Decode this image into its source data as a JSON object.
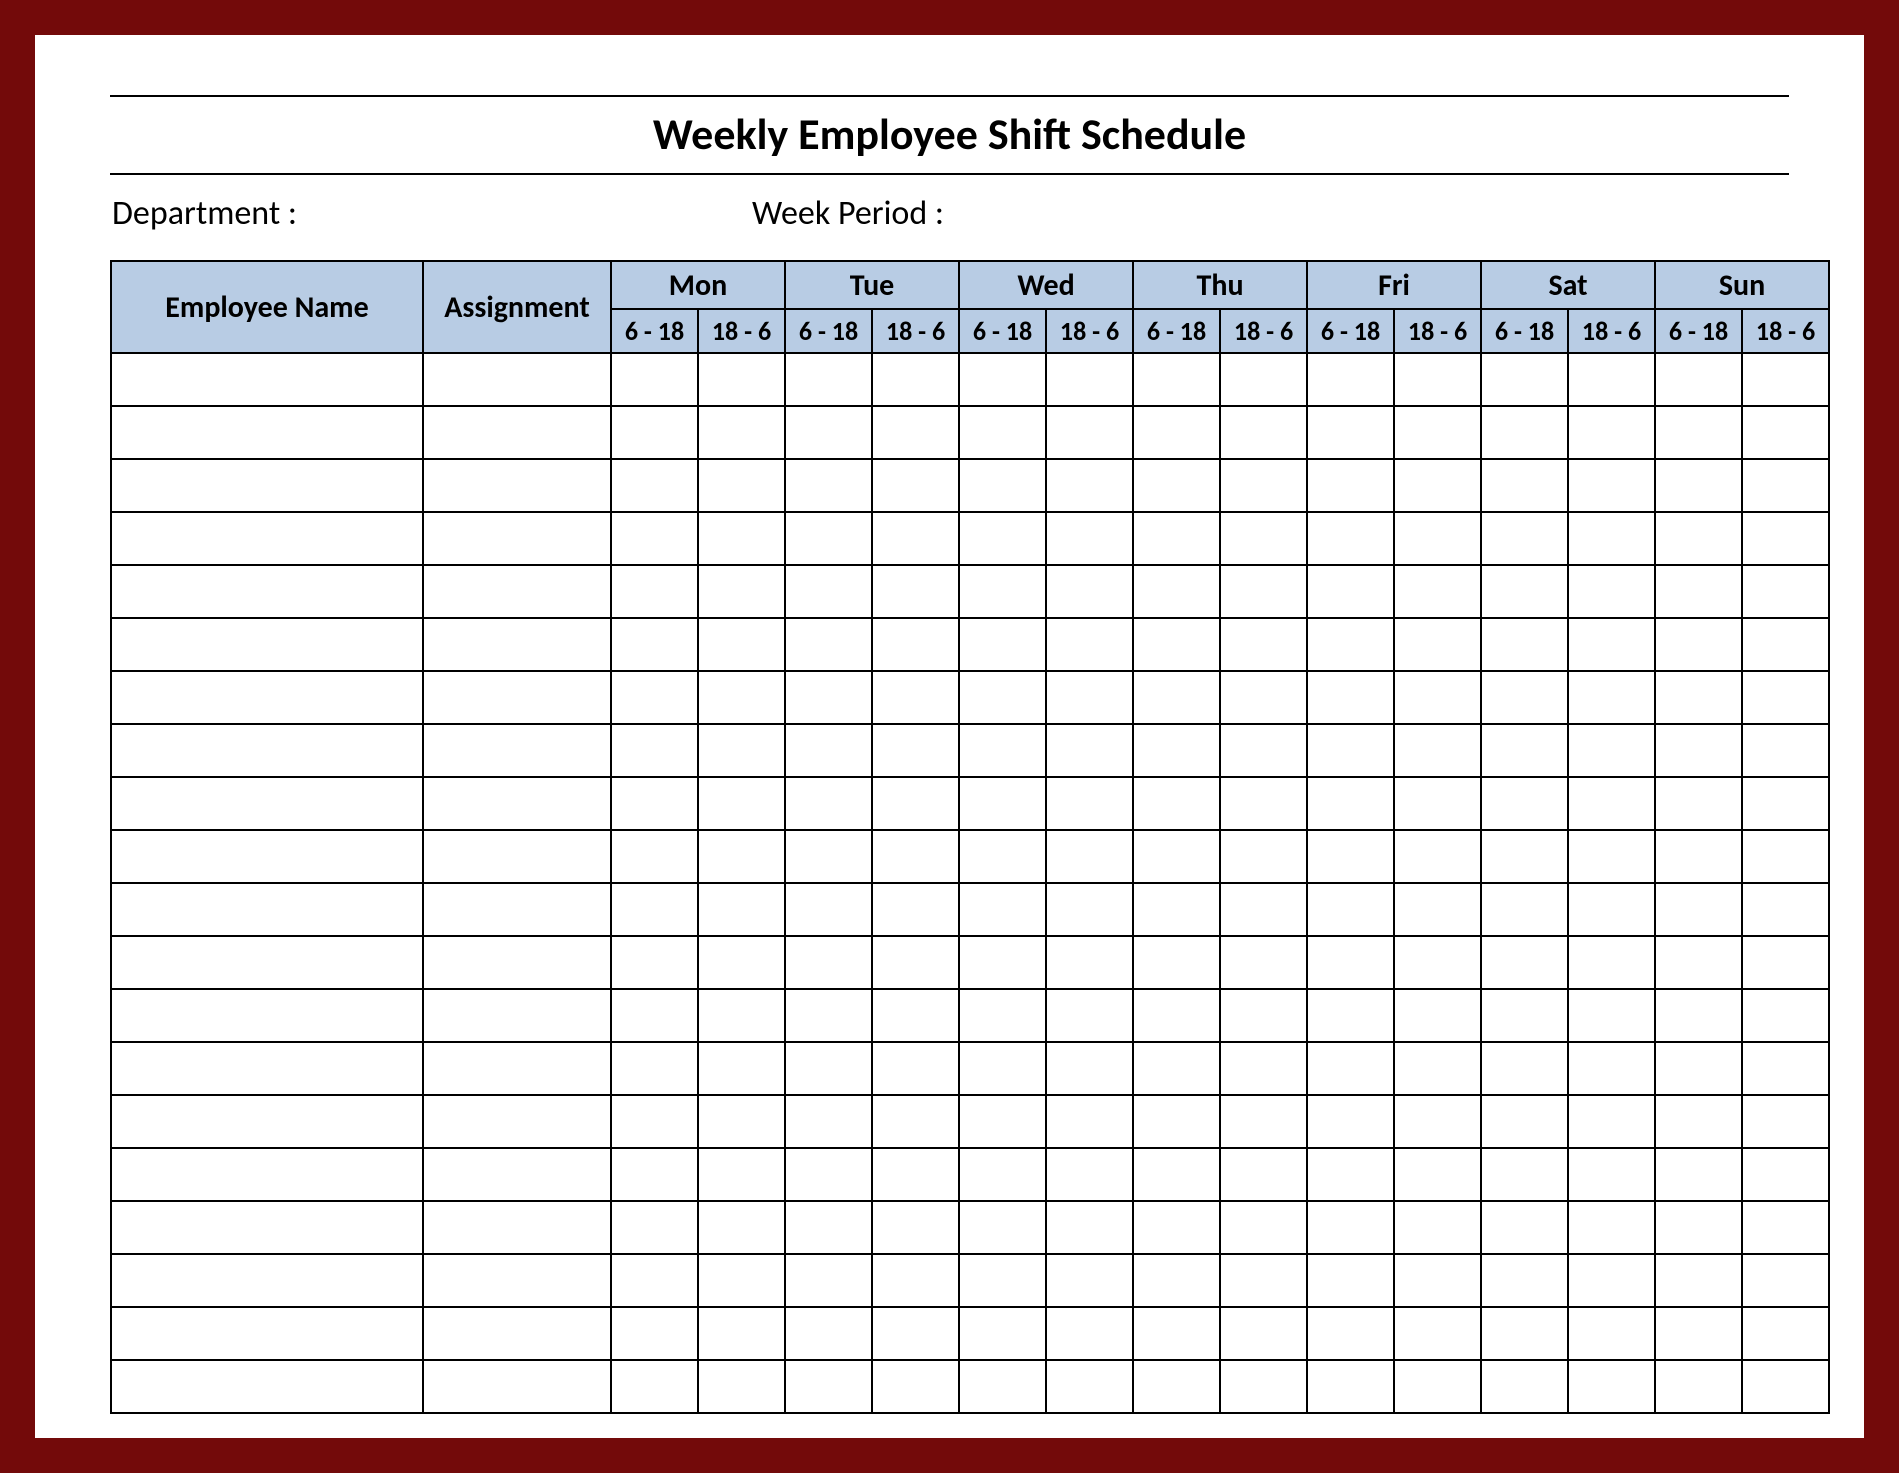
{
  "title": "Weekly Employee Shift Schedule",
  "meta": {
    "department_label": "Department :",
    "week_period_label": "Week  Period :"
  },
  "columns": {
    "employee_name": "Employee Name",
    "assignment": "Assignment",
    "days": [
      "Mon",
      "Tue",
      "Wed",
      "Thu",
      "Fri",
      "Sat",
      "Sun"
    ],
    "shifts": [
      "6 - 18",
      "18 - 6"
    ]
  },
  "row_count": 20
}
